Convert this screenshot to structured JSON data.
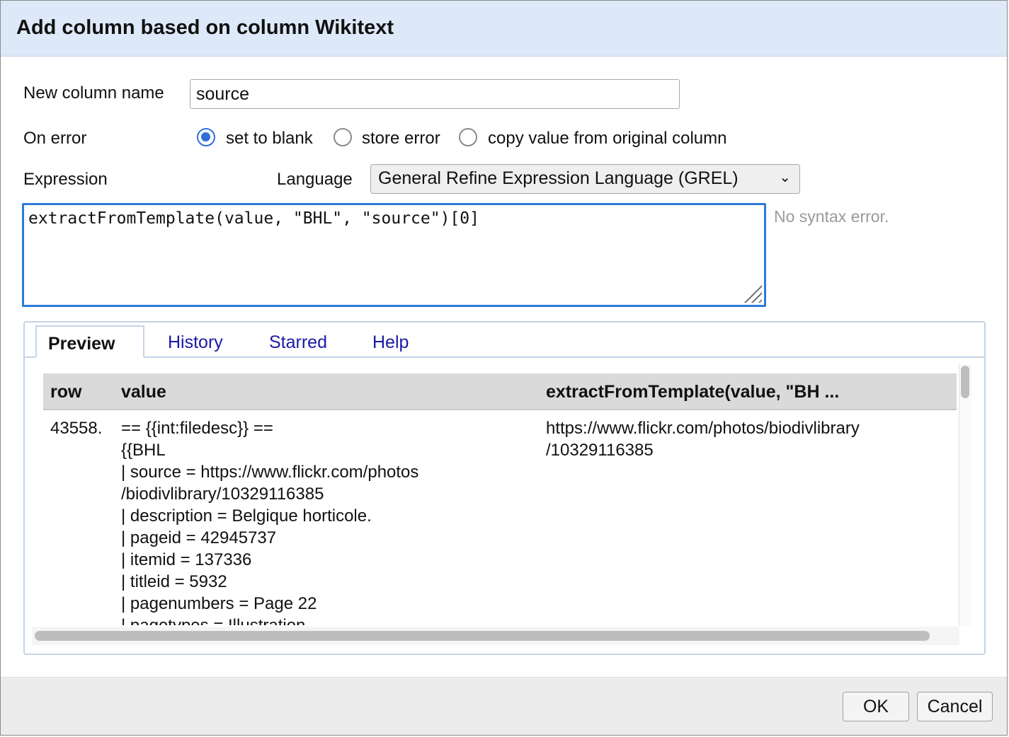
{
  "dialog": {
    "title": "Add column based on column Wikitext"
  },
  "form": {
    "new_column_label": "New column name",
    "new_column_value": "source",
    "on_error_label": "On error",
    "on_error_options": [
      {
        "label": "set to blank",
        "selected": true
      },
      {
        "label": "store error",
        "selected": false
      },
      {
        "label": "copy value from original column",
        "selected": false
      }
    ],
    "expression_label": "Expression",
    "language_label": "Language",
    "language_value": "General Refine Expression Language (GREL)",
    "expression_value": "extractFromTemplate(value, \"BHL\", \"source\")[0]",
    "syntax_status": "No syntax error."
  },
  "tabs": [
    {
      "label": "Preview",
      "active": true
    },
    {
      "label": "History",
      "active": false
    },
    {
      "label": "Starred",
      "active": false
    },
    {
      "label": "Help",
      "active": false
    }
  ],
  "preview_table": {
    "columns": [
      "row",
      "value",
      "extractFromTemplate(value, \"BH ..."
    ],
    "rows": [
      {
        "row": "43558.",
        "value_lines": [
          "== {{int:filedesc}} ==",
          "{{BHL",
          "| source = https://www.flickr.com/photos",
          "/biodivlibrary/10329116385",
          "| description = Belgique horticole.",
          "| pageid = 42945737",
          "| itemid = 137336",
          "| titleid = 5932",
          "| pagenumbers = Page 22",
          "| pagetypes = Illustration"
        ],
        "result_lines": [
          "https://www.flickr.com/photos/biodivlibrary",
          "/10329116385"
        ]
      }
    ]
  },
  "buttons": {
    "ok": "OK",
    "cancel": "Cancel"
  },
  "colors": {
    "titlebar_bg": "#dde9f8",
    "accent_blue": "#2e7adb",
    "link_blue": "#1a1aa6"
  }
}
